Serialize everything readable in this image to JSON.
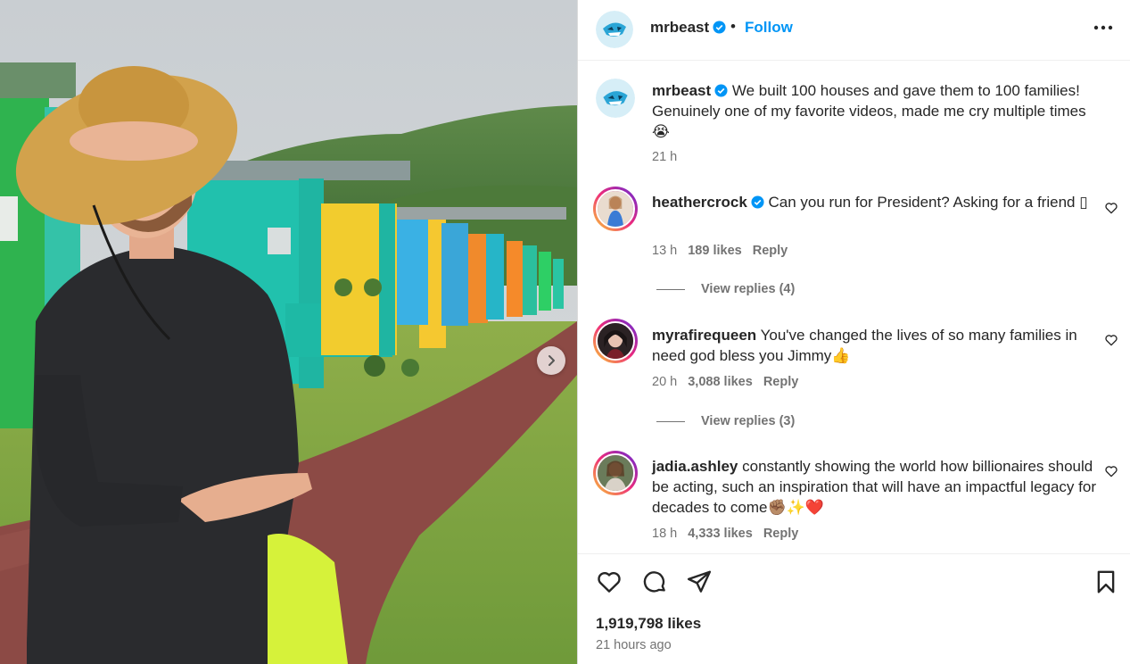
{
  "post": {
    "username": "mrbeast",
    "follow_label": "Follow",
    "dot": "•",
    "more_icon": "more-horizontal-icon"
  },
  "caption": {
    "username": "mrbeast",
    "text": "We built 100 houses and gave them to 100 families! Genuinely one of my favorite videos, made me cry multiple times 😭",
    "time": "21 h"
  },
  "comments": [
    {
      "username": "heathercrock",
      "text": "Can you run for President? Asking for a friend ▯",
      "time": "13 h",
      "likes": "189 likes",
      "reply": "Reply",
      "view_replies": "View replies (4)"
    },
    {
      "username": "myrafirequeen",
      "text": "You've changed the lives of so many families in need god bless you Jimmy👍",
      "time": "20 h",
      "likes": "3,088 likes",
      "reply": "Reply",
      "view_replies": "View replies (3)"
    },
    {
      "username": "jadia.ashley",
      "text": "constantly showing the world how billionaires should be acting, such an inspiration that will have an impactful legacy for decades to come✊🏽✨❤️",
      "time": "18 h",
      "likes": "4,333 likes",
      "reply": "Reply"
    }
  ],
  "footer": {
    "likes": "1,919,798 likes",
    "time_ago": "21 hours ago"
  },
  "colors": {
    "accent": "#0095f6",
    "verified": "#0095f6",
    "muted_text": "#737373",
    "text": "#262626"
  },
  "icons": [
    "verified-badge-icon",
    "heart-icon",
    "comment-icon",
    "share-icon",
    "bookmark-icon",
    "chevron-right-icon"
  ]
}
